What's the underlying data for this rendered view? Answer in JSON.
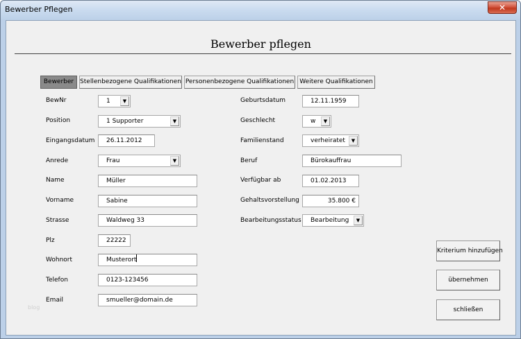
{
  "window": {
    "title": "Bewerber Pflegen",
    "close_glyph": "✕"
  },
  "form": {
    "heading": "Bewerber pflegen"
  },
  "tabs": [
    {
      "label": "Bewerber",
      "active": true
    },
    {
      "label": "Stellenbezogene Qualifikationen",
      "active": false
    },
    {
      "label": "Personenbezogene Qualifikationen",
      "active": false
    },
    {
      "label": "Weitere Qualifikationen",
      "active": false
    }
  ],
  "left": {
    "bewnr": {
      "label": "BewNr",
      "value": "1"
    },
    "position": {
      "label": "Position",
      "value": "1 Supporter"
    },
    "eingangsdatum": {
      "label": "Eingangsdatum",
      "value": "26.11.2012"
    },
    "anrede": {
      "label": "Anrede",
      "value": "Frau"
    },
    "name": {
      "label": "Name",
      "value": "Müller"
    },
    "vorname": {
      "label": "Vorname",
      "value": "Sabine"
    },
    "strasse": {
      "label": "Strasse",
      "value": "Waldweg 33"
    },
    "plz": {
      "label": "Plz",
      "value": "22222"
    },
    "wohnort": {
      "label": "Wohnort",
      "value": "Musterort"
    },
    "telefon": {
      "label": "Telefon",
      "value": "0123-123456"
    },
    "email": {
      "label": "Email",
      "value": "smueller@domain.de"
    }
  },
  "right": {
    "geburtsdatum": {
      "label": "Geburtsdatum",
      "value": "12.11.1959"
    },
    "geschlecht": {
      "label": "Geschlecht",
      "value": "w"
    },
    "familienstand": {
      "label": "Familienstand",
      "value": "verheiratet"
    },
    "beruf": {
      "label": "Beruf",
      "value": "Bürokauffrau"
    },
    "verfuegbar": {
      "label": "Verfügbar ab",
      "value": "01.02.2013"
    },
    "gehalt": {
      "label": "Gehaltsvorstellung",
      "value": "35.800 €"
    },
    "bearbeitungsstatus": {
      "label": "Bearbeitungsstatus",
      "value": "Bearbeitung"
    }
  },
  "buttons": {
    "kriterium": "Kriterium hinzufügen",
    "uebernehmen": "übernehmen",
    "schliessen": "schließen"
  },
  "dropdown_arrow": "▼",
  "watermark": "blog"
}
